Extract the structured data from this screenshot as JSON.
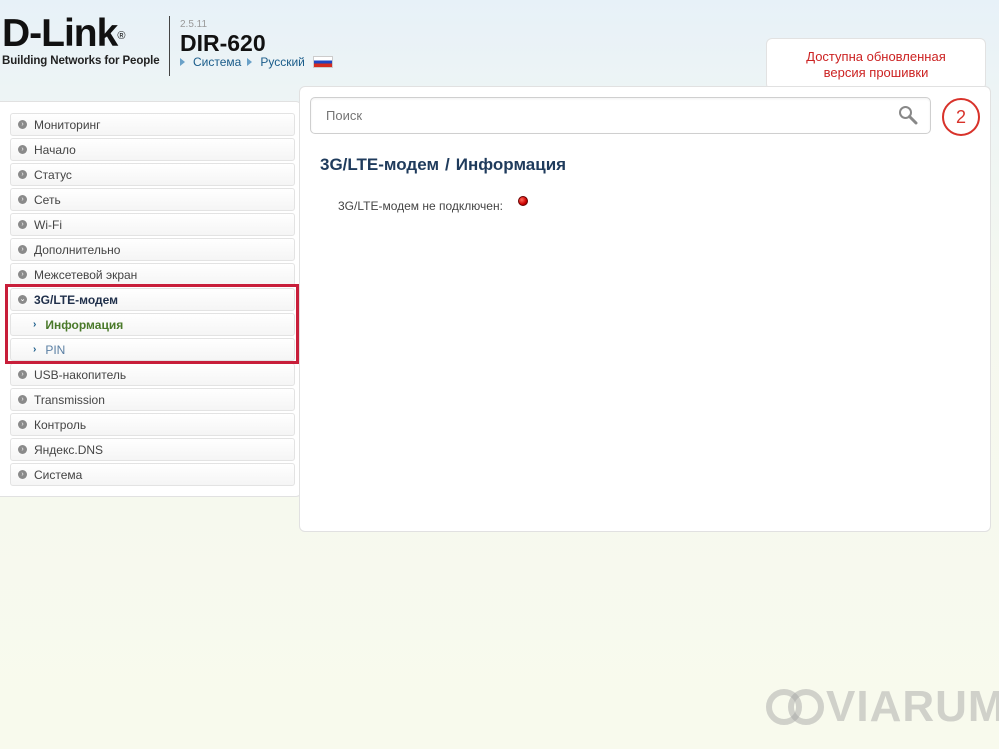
{
  "header": {
    "logo_text": "D-Link",
    "logo_reg": "®",
    "logo_tagline": "Building Networks for People",
    "firmware_version": "2.5.11",
    "model": "DIR-620",
    "nav_system": "Система",
    "nav_language": "Русский"
  },
  "notification": {
    "line1": "Доступна обновленная",
    "line2": "версия прошивки",
    "count": "2"
  },
  "search": {
    "placeholder": "Поиск"
  },
  "sidebar": {
    "items": [
      {
        "label": "Мониторинг"
      },
      {
        "label": "Начало"
      },
      {
        "label": "Статус"
      },
      {
        "label": "Сеть"
      },
      {
        "label": "Wi-Fi"
      },
      {
        "label": "Дополнительно"
      },
      {
        "label": "Межсетевой экран"
      },
      {
        "label": "3G/LTE-модем"
      },
      {
        "label": "Информация"
      },
      {
        "label": "PIN"
      },
      {
        "label": "USB-накопитель"
      },
      {
        "label": "Transmission"
      },
      {
        "label": "Контроль"
      },
      {
        "label": "Яндекс.DNS"
      },
      {
        "label": "Система"
      }
    ]
  },
  "main": {
    "breadcrumb_parent": "3G/LTE-модем",
    "breadcrumb_sep": "/",
    "breadcrumb_current": "Информация",
    "status_label": "3G/LTE-модем не подключен:",
    "status_color": "#cc0000"
  },
  "watermark": {
    "text": "VIARUM"
  },
  "colors": {
    "accent_red": "#d8322a",
    "highlight_red": "#c81e3a",
    "link_blue": "#1a5c8a",
    "active_green": "#4a7a2a"
  }
}
